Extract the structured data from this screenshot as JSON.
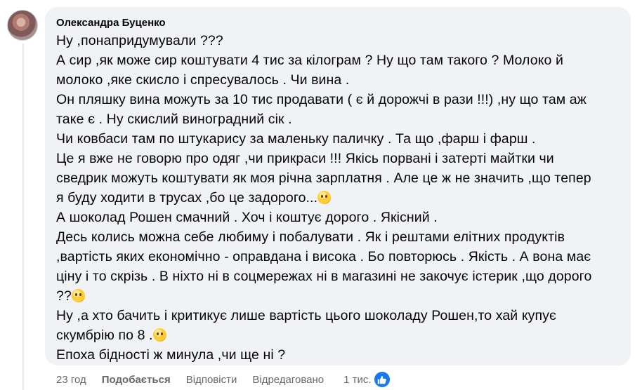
{
  "comment": {
    "author": "Олександра Буценко",
    "lines": [
      "Ну ,понапридумували ???",
      "А сир ,як може сир коштувати 4 тис за кілограм ? Ну що там такого ? Молоко й",
      "молоко ,яке скисло і спресувалось . Чи вина .",
      "Он пляшку вина можуть за 10 тис продавати ( є й дорожчі в рази !!!) ,ну що там аж",
      "таке є . Ну скислий виноградний сік .",
      "Чи ковбаси там по штукарису за маленьку паличку . Та що ,фарш і фарш .",
      "Це я вже не говорю про одяг ,чи прикраси !!! Якісь порвані і затерті майтки чи",
      "сведрик можуть коштувати як моя річна зарплатня . Але це ж не значить ,що тепер",
      "я буду ходити в трусах ,бо це задорого...",
      "А шоколад Рошен смачний . Хоч і коштує дорого . Якісний .",
      "Десь колись можна себе любиму і побалувати . Як і рештами елітних продуктів",
      ",вартість яких економічно - оправдана і висока . Бо повторюсь . Якість . А вона має",
      "ціну і то скрізь . В ніхто ні в соцмережах ні в магазині не закочує істерик ,що дорого",
      "??",
      "Ну ,а хто бачить і критикує лише вартість цього шоколаду Рошен,то хай купує",
      "скумбрію по 8 .",
      "Епоха бідності ж минула ,чи ще ні ?"
    ]
  },
  "actions": {
    "time": "23 год",
    "like": "Подобається",
    "reply": "Відповісти",
    "edited": "Відредаговано",
    "reaction_count": "1 тис."
  },
  "colors": {
    "bubble": "#f0f2f5",
    "meta": "#65676b",
    "like_blue": "#1877f2"
  },
  "icons": [
    "avatar",
    "wink-emoji",
    "thinking-emoji",
    "smile-emoji",
    "like-icon"
  ]
}
